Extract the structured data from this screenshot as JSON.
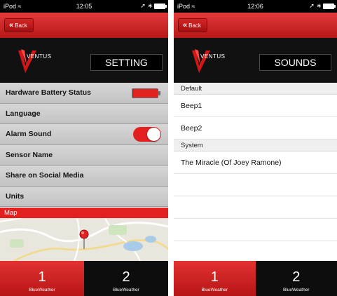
{
  "left": {
    "status": {
      "carrier": "iPod ≈",
      "time": "12:05",
      "indicators": "➚ ∗"
    },
    "nav": {
      "back_label": "Back"
    },
    "brand": {
      "logo_text": "VENTUS",
      "title": "SETTING"
    },
    "settings": [
      {
        "label": "Hardware Battery Status",
        "control": "battery"
      },
      {
        "label": "Language",
        "control": "none"
      },
      {
        "label": "Alarm Sound",
        "control": "toggle",
        "on": true
      },
      {
        "label": "Sensor Name",
        "control": "none"
      },
      {
        "label": "Share on Social Media",
        "control": "none"
      },
      {
        "label": "Units",
        "control": "none"
      }
    ],
    "map_header": "Map",
    "tabs": [
      {
        "number": "1",
        "caption": "BlueWeather",
        "active": true
      },
      {
        "number": "2",
        "caption": "BlueWeather",
        "active": false
      }
    ]
  },
  "right": {
    "status": {
      "carrier": "iPod ≈",
      "time": "12:06",
      "indicators": "➚ ∗"
    },
    "nav": {
      "back_label": "Back"
    },
    "brand": {
      "logo_text": "VENTUS",
      "title": "SOUNDS"
    },
    "sections": [
      {
        "header": "Default",
        "items": [
          "Beep1",
          "Beep2"
        ]
      },
      {
        "header": "System",
        "items": [
          "The Miracle (Of Joey Ramone)"
        ]
      }
    ],
    "tabs": [
      {
        "number": "1",
        "caption": "BlueWeather",
        "active": true
      },
      {
        "number": "2",
        "caption": "BlueWeather",
        "active": false
      }
    ]
  },
  "colors": {
    "accent_red": "#e32020",
    "brand_black": "#111111",
    "list_gray": "#cdcdcd"
  }
}
